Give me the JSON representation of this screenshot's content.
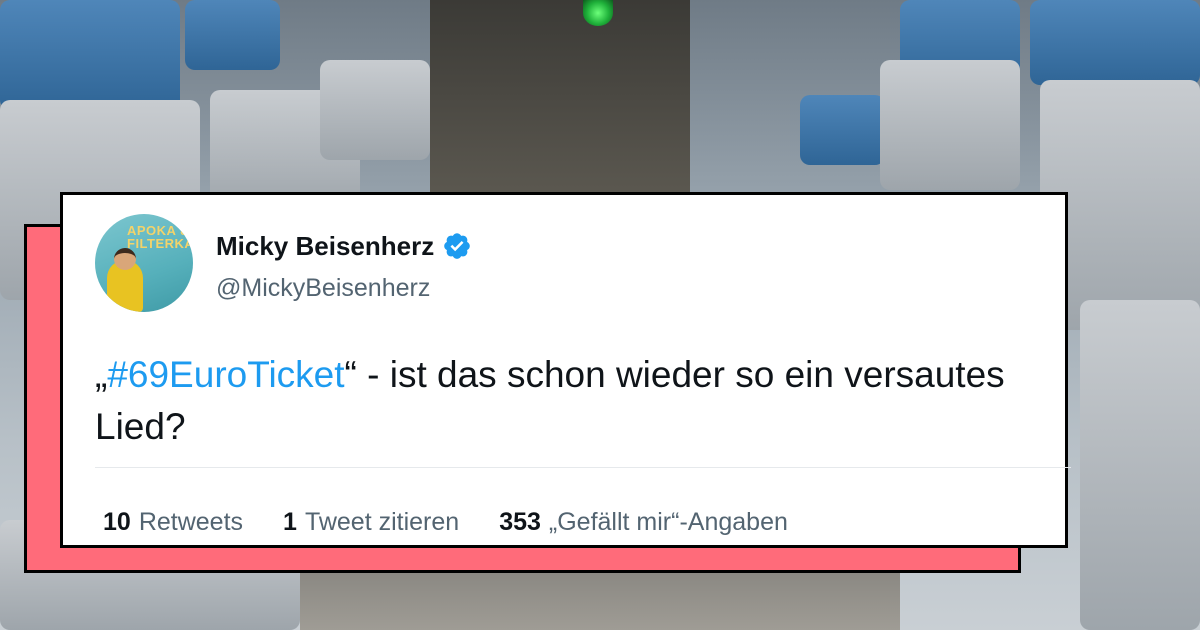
{
  "tweet": {
    "avatar_text": "APOKA & FILTERKA",
    "display_name": "Micky Beisenherz",
    "handle": "@MickyBeisenherz",
    "verified": true,
    "text_open_quote": "„",
    "hashtag": "#69EuroTicket",
    "text_rest": "“ - ist das schon wieder so ein versautes Lied?",
    "stats": [
      {
        "number": "10",
        "label": "Retweets"
      },
      {
        "number": "1",
        "label": "Tweet zitieren"
      },
      {
        "number": "353",
        "label": "„Gefällt mir“-Angaben"
      }
    ]
  },
  "colors": {
    "panel_accent": "#ff6b7a",
    "hashtag": "#1d9bf0",
    "verified": "#1d9bf0",
    "secondary_text": "#536471"
  },
  "icons": [
    "verified-badge-icon",
    "avatar-image"
  ]
}
